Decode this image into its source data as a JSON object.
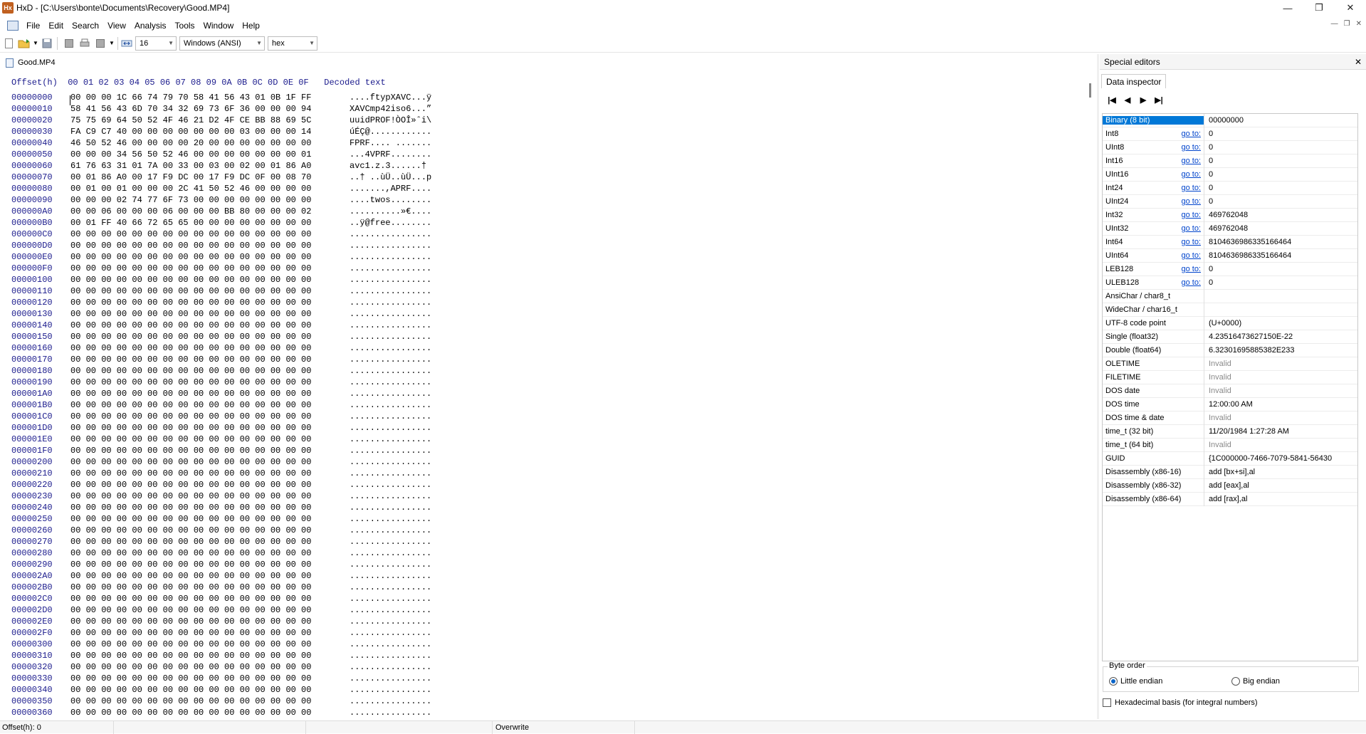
{
  "window": {
    "title": "HxD - [C:\\Users\\bonte\\Documents\\Recovery\\Good.MP4]",
    "app_icon_text": "Hx"
  },
  "menu": [
    "File",
    "Edit",
    "Search",
    "View",
    "Analysis",
    "Tools",
    "Window",
    "Help"
  ],
  "toolbar": {
    "columns_value": "16",
    "encoding_value": "Windows (ANSI)",
    "base_value": "hex"
  },
  "document_tab": {
    "label": "Good.MP4"
  },
  "hex_view": {
    "header": "Offset(h)  00 01 02 03 04 05 06 07 08 09 0A 0B 0C 0D 0E 0F   Decoded text",
    "rows": [
      {
        "offset": "00000000",
        "bytes": "00 00 00 1C 66 74 79 70 58 41 56 43 01 0B 1F FF",
        "text": "....ftypXAVC...ÿ"
      },
      {
        "offset": "00000010",
        "bytes": "58 41 56 43 6D 70 34 32 69 73 6F 36 00 00 00 94",
        "text": "XAVCmp42iso6...”"
      },
      {
        "offset": "00000020",
        "bytes": "75 75 69 64 50 52 4F 46 21 D2 4F CE BB 88 69 5C",
        "text": "uuidPROF!ÒOÎ»ˆi\\"
      },
      {
        "offset": "00000030",
        "bytes": "FA C9 C7 40 00 00 00 00 00 00 00 03 00 00 00 14",
        "text": "úÉÇ@............"
      },
      {
        "offset": "00000040",
        "bytes": "46 50 52 46 00 00 00 00 20 00 00 00 00 00 00 00",
        "text": "FPRF.... ......."
      },
      {
        "offset": "00000050",
        "bytes": "00 00 00 34 56 50 52 46 00 00 00 00 00 00 00 01",
        "text": "...4VPRF........"
      },
      {
        "offset": "00000060",
        "bytes": "61 76 63 31 01 7A 00 33 00 03 00 02 00 01 86 A0",
        "text": "avc1.z.3......†"
      },
      {
        "offset": "00000070",
        "bytes": "00 01 86 A0 00 17 F9 DC 00 17 F9 DC 0F 00 08 70",
        "text": "..† ..ùÜ..ùÜ...p"
      },
      {
        "offset": "00000080",
        "bytes": "00 01 00 01 00 00 00 2C 41 50 52 46 00 00 00 00",
        "text": ".......,APRF...."
      },
      {
        "offset": "00000090",
        "bytes": "00 00 00 02 74 77 6F 73 00 00 00 00 00 00 00 00",
        "text": "....twos........"
      },
      {
        "offset": "000000A0",
        "bytes": "00 00 06 00 00 00 06 00 00 00 BB 80 00 00 00 02",
        "text": "..........»€...."
      },
      {
        "offset": "000000B0",
        "bytes": "00 01 FF 40 66 72 65 65 00 00 00 00 00 00 00 00",
        "text": "..ÿ@free........"
      },
      {
        "offset": "000000C0",
        "bytes": "00 00 00 00 00 00 00 00 00 00 00 00 00 00 00 00",
        "text": "................"
      },
      {
        "offset": "000000D0",
        "bytes": "00 00 00 00 00 00 00 00 00 00 00 00 00 00 00 00",
        "text": "................"
      },
      {
        "offset": "000000E0",
        "bytes": "00 00 00 00 00 00 00 00 00 00 00 00 00 00 00 00",
        "text": "................"
      },
      {
        "offset": "000000F0",
        "bytes": "00 00 00 00 00 00 00 00 00 00 00 00 00 00 00 00",
        "text": "................"
      },
      {
        "offset": "00000100",
        "bytes": "00 00 00 00 00 00 00 00 00 00 00 00 00 00 00 00",
        "text": "................"
      },
      {
        "offset": "00000110",
        "bytes": "00 00 00 00 00 00 00 00 00 00 00 00 00 00 00 00",
        "text": "................"
      },
      {
        "offset": "00000120",
        "bytes": "00 00 00 00 00 00 00 00 00 00 00 00 00 00 00 00",
        "text": "................"
      },
      {
        "offset": "00000130",
        "bytes": "00 00 00 00 00 00 00 00 00 00 00 00 00 00 00 00",
        "text": "................"
      },
      {
        "offset": "00000140",
        "bytes": "00 00 00 00 00 00 00 00 00 00 00 00 00 00 00 00",
        "text": "................"
      },
      {
        "offset": "00000150",
        "bytes": "00 00 00 00 00 00 00 00 00 00 00 00 00 00 00 00",
        "text": "................"
      },
      {
        "offset": "00000160",
        "bytes": "00 00 00 00 00 00 00 00 00 00 00 00 00 00 00 00",
        "text": "................"
      },
      {
        "offset": "00000170",
        "bytes": "00 00 00 00 00 00 00 00 00 00 00 00 00 00 00 00",
        "text": "................"
      },
      {
        "offset": "00000180",
        "bytes": "00 00 00 00 00 00 00 00 00 00 00 00 00 00 00 00",
        "text": "................"
      },
      {
        "offset": "00000190",
        "bytes": "00 00 00 00 00 00 00 00 00 00 00 00 00 00 00 00",
        "text": "................"
      },
      {
        "offset": "000001A0",
        "bytes": "00 00 00 00 00 00 00 00 00 00 00 00 00 00 00 00",
        "text": "................"
      },
      {
        "offset": "000001B0",
        "bytes": "00 00 00 00 00 00 00 00 00 00 00 00 00 00 00 00",
        "text": "................"
      },
      {
        "offset": "000001C0",
        "bytes": "00 00 00 00 00 00 00 00 00 00 00 00 00 00 00 00",
        "text": "................"
      },
      {
        "offset": "000001D0",
        "bytes": "00 00 00 00 00 00 00 00 00 00 00 00 00 00 00 00",
        "text": "................"
      },
      {
        "offset": "000001E0",
        "bytes": "00 00 00 00 00 00 00 00 00 00 00 00 00 00 00 00",
        "text": "................"
      },
      {
        "offset": "000001F0",
        "bytes": "00 00 00 00 00 00 00 00 00 00 00 00 00 00 00 00",
        "text": "................"
      },
      {
        "offset": "00000200",
        "bytes": "00 00 00 00 00 00 00 00 00 00 00 00 00 00 00 00",
        "text": "................"
      },
      {
        "offset": "00000210",
        "bytes": "00 00 00 00 00 00 00 00 00 00 00 00 00 00 00 00",
        "text": "................"
      },
      {
        "offset": "00000220",
        "bytes": "00 00 00 00 00 00 00 00 00 00 00 00 00 00 00 00",
        "text": "................"
      },
      {
        "offset": "00000230",
        "bytes": "00 00 00 00 00 00 00 00 00 00 00 00 00 00 00 00",
        "text": "................"
      },
      {
        "offset": "00000240",
        "bytes": "00 00 00 00 00 00 00 00 00 00 00 00 00 00 00 00",
        "text": "................"
      },
      {
        "offset": "00000250",
        "bytes": "00 00 00 00 00 00 00 00 00 00 00 00 00 00 00 00",
        "text": "................"
      },
      {
        "offset": "00000260",
        "bytes": "00 00 00 00 00 00 00 00 00 00 00 00 00 00 00 00",
        "text": "................"
      },
      {
        "offset": "00000270",
        "bytes": "00 00 00 00 00 00 00 00 00 00 00 00 00 00 00 00",
        "text": "................"
      },
      {
        "offset": "00000280",
        "bytes": "00 00 00 00 00 00 00 00 00 00 00 00 00 00 00 00",
        "text": "................"
      },
      {
        "offset": "00000290",
        "bytes": "00 00 00 00 00 00 00 00 00 00 00 00 00 00 00 00",
        "text": "................"
      },
      {
        "offset": "000002A0",
        "bytes": "00 00 00 00 00 00 00 00 00 00 00 00 00 00 00 00",
        "text": "................"
      },
      {
        "offset": "000002B0",
        "bytes": "00 00 00 00 00 00 00 00 00 00 00 00 00 00 00 00",
        "text": "................"
      },
      {
        "offset": "000002C0",
        "bytes": "00 00 00 00 00 00 00 00 00 00 00 00 00 00 00 00",
        "text": "................"
      },
      {
        "offset": "000002D0",
        "bytes": "00 00 00 00 00 00 00 00 00 00 00 00 00 00 00 00",
        "text": "................"
      },
      {
        "offset": "000002E0",
        "bytes": "00 00 00 00 00 00 00 00 00 00 00 00 00 00 00 00",
        "text": "................"
      },
      {
        "offset": "000002F0",
        "bytes": "00 00 00 00 00 00 00 00 00 00 00 00 00 00 00 00",
        "text": "................"
      },
      {
        "offset": "00000300",
        "bytes": "00 00 00 00 00 00 00 00 00 00 00 00 00 00 00 00",
        "text": "................"
      },
      {
        "offset": "00000310",
        "bytes": "00 00 00 00 00 00 00 00 00 00 00 00 00 00 00 00",
        "text": "................"
      },
      {
        "offset": "00000320",
        "bytes": "00 00 00 00 00 00 00 00 00 00 00 00 00 00 00 00",
        "text": "................"
      },
      {
        "offset": "00000330",
        "bytes": "00 00 00 00 00 00 00 00 00 00 00 00 00 00 00 00",
        "text": "................"
      },
      {
        "offset": "00000340",
        "bytes": "00 00 00 00 00 00 00 00 00 00 00 00 00 00 00 00",
        "text": "................"
      },
      {
        "offset": "00000350",
        "bytes": "00 00 00 00 00 00 00 00 00 00 00 00 00 00 00 00",
        "text": "................"
      },
      {
        "offset": "00000360",
        "bytes": "00 00 00 00 00 00 00 00 00 00 00 00 00 00 00 00",
        "text": "................"
      }
    ]
  },
  "special_editors": {
    "title": "Special editors",
    "tab": "Data inspector",
    "goto_label": "go to:",
    "rows": [
      {
        "label": "Binary (8 bit)",
        "value": "00000000",
        "goto": false,
        "selected": true
      },
      {
        "label": "Int8",
        "value": "0",
        "goto": true
      },
      {
        "label": "UInt8",
        "value": "0",
        "goto": true
      },
      {
        "label": "Int16",
        "value": "0",
        "goto": true
      },
      {
        "label": "UInt16",
        "value": "0",
        "goto": true
      },
      {
        "label": "Int24",
        "value": "0",
        "goto": true
      },
      {
        "label": "UInt24",
        "value": "0",
        "goto": true
      },
      {
        "label": "Int32",
        "value": "469762048",
        "goto": true
      },
      {
        "label": "UInt32",
        "value": "469762048",
        "goto": true
      },
      {
        "label": "Int64",
        "value": "8104636986335166464",
        "goto": true
      },
      {
        "label": "UInt64",
        "value": "8104636986335166464",
        "goto": true
      },
      {
        "label": "LEB128",
        "value": "0",
        "goto": true
      },
      {
        "label": "ULEB128",
        "value": "0",
        "goto": true
      },
      {
        "label": "AnsiChar / char8_t",
        "value": "",
        "goto": false
      },
      {
        "label": "WideChar / char16_t",
        "value": "",
        "goto": false
      },
      {
        "label": "UTF-8 code point",
        "value": "  (U+0000)",
        "goto": false
      },
      {
        "label": "Single (float32)",
        "value": "4.23516473627150E-22",
        "goto": false
      },
      {
        "label": "Double (float64)",
        "value": "6.32301695885382E233",
        "goto": false
      },
      {
        "label": "OLETIME",
        "value": "Invalid",
        "goto": false,
        "invalid": true
      },
      {
        "label": "FILETIME",
        "value": "Invalid",
        "goto": false,
        "invalid": true
      },
      {
        "label": "DOS date",
        "value": "Invalid",
        "goto": false,
        "invalid": true
      },
      {
        "label": "DOS time",
        "value": "12:00:00 AM",
        "goto": false
      },
      {
        "label": "DOS time & date",
        "value": "Invalid",
        "goto": false,
        "invalid": true
      },
      {
        "label": "time_t (32 bit)",
        "value": "11/20/1984 1:27:28 AM",
        "goto": false
      },
      {
        "label": "time_t (64 bit)",
        "value": "Invalid",
        "goto": false,
        "invalid": true
      },
      {
        "label": "GUID",
        "value": "{1C000000-7466-7079-5841-56430",
        "goto": false
      },
      {
        "label": "Disassembly (x86-16)",
        "value": "add [bx+si],al",
        "goto": false
      },
      {
        "label": "Disassembly (x86-32)",
        "value": "add [eax],al",
        "goto": false
      },
      {
        "label": "Disassembly (x86-64)",
        "value": "add [rax],al",
        "goto": false
      }
    ],
    "byte_order": {
      "legend": "Byte order",
      "little": "Little endian",
      "big": "Big endian",
      "selected": "little"
    },
    "hex_basis_label": "Hexadecimal basis (for integral numbers)"
  },
  "status": {
    "offset": "Offset(h): 0",
    "mode": "Overwrite"
  }
}
